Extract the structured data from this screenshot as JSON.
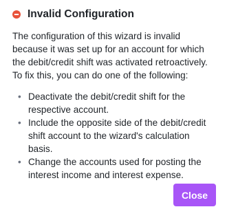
{
  "dialog": {
    "icon": "error-circle-icon",
    "icon_color": "#e8523a",
    "title": "Invalid Configuration",
    "message": "The configuration of this wizard is invalid because it was set up for an account for which the debit/credit shift was activated retroactively. To fix this, you can do one of the following:",
    "options": [
      {
        "text": "Deactivate the debit/credit shift for the respective account."
      },
      {
        "text": "Include the opposite side of the debit/credit shift account to the wizard's calculation basis."
      },
      {
        "text": "Change the accounts used for posting the interest income and interest expense."
      }
    ],
    "close_label": "Close",
    "accent_color": "#a855f7"
  }
}
